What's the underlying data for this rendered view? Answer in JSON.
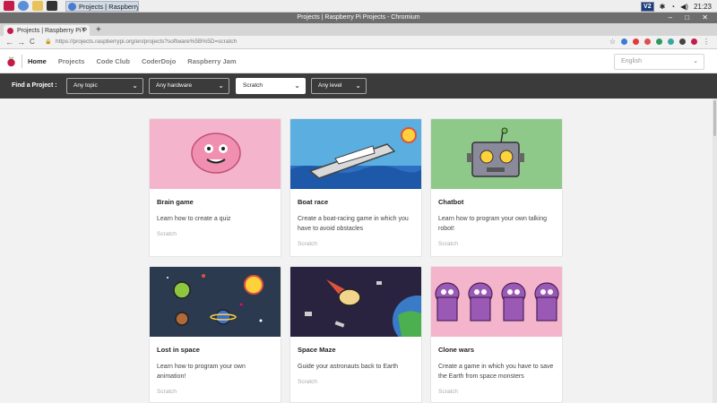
{
  "taskbar": {
    "task_label": "Projects | Raspberry ...",
    "tray_vnc": "V2",
    "clock": "21:23",
    "tray_icons": [
      "bluetooth-icon",
      "wifi-icon",
      "volume-icon"
    ]
  },
  "window": {
    "title": "Projects | Raspberry Pi Projects - Chromium",
    "controls": "‒ □ ✕"
  },
  "browser": {
    "tab_title": "Projects | Raspberry Pi P",
    "tab_close": "✕",
    "new_tab": "+",
    "back": "←",
    "forward": "→",
    "reload": "C",
    "lock": "🔒",
    "url": "https://projects.raspberrypi.org/en/projects?software%5B%5D=scratch",
    "star": "☆"
  },
  "site": {
    "nav": [
      "Home",
      "Projects",
      "Code Club",
      "CoderDojo",
      "Raspberry Jam"
    ],
    "active_nav": "Home",
    "language": "English"
  },
  "filters": {
    "label": "Find a Project :",
    "topic": "Any topic",
    "hardware": "Any hardware",
    "software": "Scratch",
    "level": "Any level"
  },
  "projects": [
    {
      "title": "Brain game",
      "description": "Learn how to create a quiz",
      "tag": "Scratch",
      "bg": "#f4b5cc"
    },
    {
      "title": "Boat race",
      "description": "Create a boat-racing game in which you have to avoid obstacles",
      "tag": "Scratch",
      "bg": "#5aaee0"
    },
    {
      "title": "Chatbot",
      "description": "Learn how to program your own talking robot!",
      "tag": "Scratch",
      "bg": "#8fc98a"
    },
    {
      "title": "Lost in space",
      "description": "Learn how to program your own animation!",
      "tag": "Scratch",
      "bg": "#2b3a4f"
    },
    {
      "title": "Space Maze",
      "description": "Guide your astronauts back to Earth",
      "tag": "Scratch",
      "bg": "#2a2340"
    },
    {
      "title": "Clone wars",
      "description": "Create a game in which you have to save the Earth from space monsters",
      "tag": "Scratch",
      "bg": "#f4b5cc"
    }
  ],
  "colors": {
    "accent": "#c51a4a",
    "filterbar": "#3b3b3b"
  }
}
